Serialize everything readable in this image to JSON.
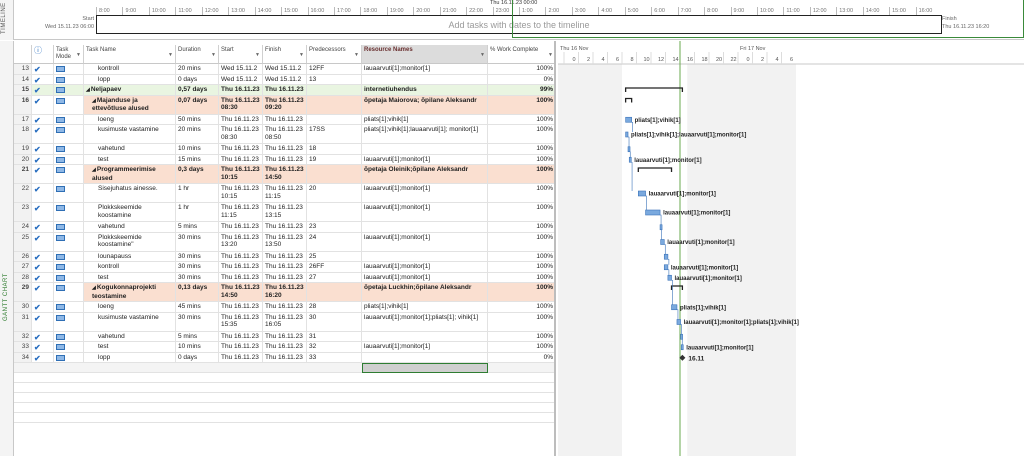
{
  "timeline": {
    "side_label": "TIMELINE",
    "today_label": "Thu 16.11.23 00:00",
    "start_label": "Start",
    "start_date": "Wed 15.11.23 06:00",
    "finish_label": "Finish",
    "finish_date": "Thu 16.11.23 16:20",
    "placeholder": "Add tasks with dates to the timeline",
    "ticks": [
      "8:00",
      "9:00",
      "10:00",
      "11:00",
      "12:00",
      "13:00",
      "14:00",
      "15:00",
      "16:00",
      "17:00",
      "18:00",
      "19:00",
      "20:00",
      "21:00",
      "22:00",
      "23:00",
      "1:00",
      "2:00",
      "3:00",
      "4:00",
      "5:00",
      "6:00",
      "7:00",
      "8:00",
      "9:00",
      "10:00",
      "11:00",
      "12:00",
      "13:00",
      "14:00",
      "15:00",
      "16:00"
    ]
  },
  "gantt_side_label": "GANTT CHART",
  "columns": {
    "info": "ⓘ",
    "mode": "Task Mode",
    "name": "Task Name",
    "duration": "Duration",
    "start": "Start",
    "finish": "Finish",
    "predecessors": "Predecessors",
    "resources": "Resource Names",
    "work": "% Work Complete"
  },
  "chart_header": {
    "day1": "Thu 16 Nov",
    "day2": "Fri 17 Nov",
    "hours1": [
      "0",
      "2",
      "4",
      "6",
      "8",
      "10",
      "12",
      "14",
      "16",
      "18",
      "20",
      "22"
    ],
    "hours2": [
      "0",
      "2",
      "4",
      "6"
    ]
  },
  "rows": [
    {
      "id": "13",
      "name": "kontroll",
      "duration": "20 mins",
      "start": "Wed 15.11.2",
      "finish": "Wed 15.11.2",
      "pred": "12FF",
      "res": "lauaarvuti[1];monitor[1]",
      "work": "100%",
      "level": 2
    },
    {
      "id": "14",
      "name": "lopp",
      "duration": "0 days",
      "start": "Wed 15.11.2",
      "finish": "Wed 15.11.2",
      "pred": "13",
      "res": "",
      "work": "0%",
      "level": 2
    },
    {
      "id": "15",
      "name": "Neljapaev",
      "duration": "0,57 days",
      "start": "Thu 16.11.23",
      "finish": "Thu 16.11.23",
      "pred": "",
      "res": "internetiuhendus",
      "work": "99%",
      "level": 0,
      "summary": true,
      "band": true
    },
    {
      "id": "16",
      "name": "Majanduse ja ettevõtluse alused",
      "duration": "0,07 days",
      "start": "Thu 16.11.23 08:30",
      "finish": "Thu 16.11.23 09:20",
      "pred": "",
      "res": "õpetaja Maiorova; õpilane Aleksandr",
      "work": "100%",
      "level": 1,
      "summary": true,
      "tall": true
    },
    {
      "id": "17",
      "name": "loeng",
      "duration": "50 mins",
      "start": "Thu 16.11.23",
      "finish": "Thu 16.11.23",
      "pred": "",
      "res": "pliats[1];vihik[1]",
      "work": "100%",
      "level": 2
    },
    {
      "id": "18",
      "name": "kusimuste vastamine",
      "duration": "20 mins",
      "start": "Thu 16.11.23 08:30",
      "finish": "Thu 16.11.23 08:50",
      "pred": "17SS",
      "res": "pliats[1];vihik[1];lauaarvuti[1]; monitor[1]",
      "work": "100%",
      "level": 2,
      "tall": true
    },
    {
      "id": "19",
      "name": "vahetund",
      "duration": "10 mins",
      "start": "Thu 16.11.23",
      "finish": "Thu 16.11.23",
      "pred": "18",
      "res": "",
      "work": "100%",
      "level": 2
    },
    {
      "id": "20",
      "name": "test",
      "duration": "15 mins",
      "start": "Thu 16.11.23",
      "finish": "Thu 16.11.23",
      "pred": "19",
      "res": "lauaarvuti[1];monitor[1]",
      "work": "100%",
      "level": 2
    },
    {
      "id": "21",
      "name": "Programmeerimise alused",
      "duration": "0,3 days",
      "start": "Thu 16.11.23 10:15",
      "finish": "Thu 16.11.23 14:50",
      "pred": "",
      "res": "õpetaja Oleinik;õpilane Aleksandr",
      "work": "100%",
      "level": 1,
      "summary": true,
      "tall": true
    },
    {
      "id": "22",
      "name": "Sisejuhatus ainesse.",
      "duration": "1 hr",
      "start": "Thu 16.11.23 10:15",
      "finish": "Thu 16.11.23 11:15",
      "pred": "20",
      "res": "lauaarvuti[1];monitor[1]",
      "work": "100%",
      "level": 2,
      "tall": true
    },
    {
      "id": "23",
      "name": "Plokkskeemide koostamine",
      "duration": "1 hr",
      "start": "Thu 16.11.23 11:15",
      "finish": "Thu 16.11.23 13:15",
      "pred": "",
      "res": "lauaarvuti[1];monitor[1]",
      "work": "100%",
      "level": 2,
      "tall": true
    },
    {
      "id": "24",
      "name": "vahetund",
      "duration": "5 mins",
      "start": "Thu 16.11.23",
      "finish": "Thu 16.11.23",
      "pred": "23",
      "res": "",
      "work": "100%",
      "level": 2
    },
    {
      "id": "25",
      "name": "Plokkskeemide koostamine\"",
      "duration": "30 mins",
      "start": "Thu 16.11.23 13:20",
      "finish": "Thu 16.11.23 13:50",
      "pred": "24",
      "res": "lauaarvuti[1];monitor[1]",
      "work": "100%",
      "level": 2,
      "tall": true
    },
    {
      "id": "26",
      "name": "lounapauss",
      "duration": "30 mins",
      "start": "Thu 16.11.23",
      "finish": "Thu 16.11.23",
      "pred": "25",
      "res": "",
      "work": "100%",
      "level": 2
    },
    {
      "id": "27",
      "name": "kontroll",
      "duration": "30 mins",
      "start": "Thu 16.11.23",
      "finish": "Thu 16.11.23",
      "pred": "26FF",
      "res": "lauaarvuti[1];monitor[1]",
      "work": "100%",
      "level": 2
    },
    {
      "id": "28",
      "name": "test",
      "duration": "30 mins",
      "start": "Thu 16.11.23",
      "finish": "Thu 16.11.23",
      "pred": "27",
      "res": "lauaarvuti[1];monitor[1]",
      "work": "100%",
      "level": 2
    },
    {
      "id": "29",
      "name": "Kogukonnaprojekti teostamine",
      "duration": "0,13 days",
      "start": "Thu 16.11.23 14:50",
      "finish": "Thu 16.11.23 16:20",
      "pred": "",
      "res": "õpetaja Luckhin;õpilane Aleksandr",
      "work": "100%",
      "level": 1,
      "summary": true,
      "tall": true
    },
    {
      "id": "30",
      "name": "loeng",
      "duration": "45 mins",
      "start": "Thu 16.11.23",
      "finish": "Thu 16.11.23",
      "pred": "28",
      "res": "pliats[1];vihik[1]",
      "work": "100%",
      "level": 2
    },
    {
      "id": "31",
      "name": "kusimuste vastamine",
      "duration": "30 mins",
      "start": "Thu 16.11.23 15:35",
      "finish": "Thu 16.11.23 16:05",
      "pred": "30",
      "res": "lauaarvuti[1];monitor[1];pliats[1]; vihik[1]",
      "work": "100%",
      "level": 2,
      "tall": true
    },
    {
      "id": "32",
      "name": "vahetund",
      "duration": "5 mins",
      "start": "Thu 16.11.23",
      "finish": "Thu 16.11.23",
      "pred": "31",
      "res": "",
      "work": "100%",
      "level": 2
    },
    {
      "id": "33",
      "name": "test",
      "duration": "10 mins",
      "start": "Thu 16.11.23",
      "finish": "Thu 16.11.23",
      "pred": "32",
      "res": "lauaarvuti[1];monitor[1]",
      "work": "100%",
      "level": 2
    },
    {
      "id": "34",
      "name": "lopp",
      "duration": "0 days",
      "start": "Thu 16.11.23",
      "finish": "Thu 16.11.23",
      "pred": "33",
      "res": "",
      "work": "0%",
      "level": 2
    }
  ],
  "bars": [
    {
      "row": "17",
      "start_h": 8.5,
      "end_h": 9.33,
      "label": "pliats[1];vihik[1]"
    },
    {
      "row": "18",
      "start_h": 8.5,
      "end_h": 8.83,
      "label": "pliats[1];vihik[1];lauaarvuti[1];monitor[1]"
    },
    {
      "row": "19",
      "start_h": 8.83,
      "end_h": 9.0,
      "label": ""
    },
    {
      "row": "20",
      "start_h": 9.0,
      "end_h": 9.25,
      "label": "lauaarvuti[1];monitor[1]"
    },
    {
      "row": "22",
      "start_h": 10.25,
      "end_h": 11.25,
      "label": "lauaarvuti[1];monitor[1]"
    },
    {
      "row": "23",
      "start_h": 11.25,
      "end_h": 13.25,
      "label": "lauaarvuti[1];monitor[1]"
    },
    {
      "row": "24",
      "start_h": 13.25,
      "end_h": 13.33,
      "label": ""
    },
    {
      "row": "25",
      "start_h": 13.33,
      "end_h": 13.83,
      "label": "lauaarvuti[1];monitor[1]"
    },
    {
      "row": "26",
      "start_h": 13.83,
      "end_h": 14.33,
      "label": ""
    },
    {
      "row": "27",
      "start_h": 13.83,
      "end_h": 14.33,
      "label": "lauaarvuti[1];monitor[1]"
    },
    {
      "row": "28",
      "start_h": 14.33,
      "end_h": 14.83,
      "label": "lauaarvuti[1];monitor[1]"
    },
    {
      "row": "30",
      "start_h": 14.83,
      "end_h": 15.58,
      "label": "pliats[1];vihik[1]"
    },
    {
      "row": "31",
      "start_h": 15.58,
      "end_h": 16.08,
      "label": "lauaarvuti[1];monitor[1];pliats[1];vihik[1]"
    },
    {
      "row": "32",
      "start_h": 16.08,
      "end_h": 16.17,
      "label": ""
    },
    {
      "row": "33",
      "start_h": 16.17,
      "end_h": 16.33,
      "label": "lauaarvuti[1];monitor[1]"
    }
  ],
  "summary_bars": [
    {
      "row": "15",
      "start_h": 8.5,
      "end_h": 16.33
    },
    {
      "row": "16",
      "start_h": 8.5,
      "end_h": 9.33
    },
    {
      "row": "21",
      "start_h": 10.25,
      "end_h": 14.83
    },
    {
      "row": "29",
      "start_h": 14.83,
      "end_h": 16.33
    }
  ],
  "milestone": {
    "row": "34",
    "at_h": 16.33,
    "label": "16.11"
  },
  "colors": {
    "bar": "#7aa9de",
    "bar_border": "#3b73b9",
    "summary_highlight": "#fadfd0",
    "band": "#e9f5e1",
    "accent_green": "#3a8a3a"
  }
}
